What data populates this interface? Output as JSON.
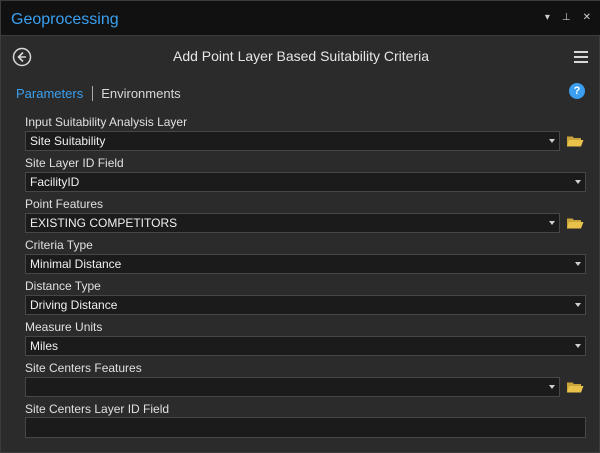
{
  "pane": {
    "title": "Geoprocessing",
    "controls": [
      "▾",
      "⊥",
      "✕"
    ]
  },
  "tool": {
    "title": "Add Point Layer Based Suitability Criteria"
  },
  "tabs": {
    "parameters": "Parameters",
    "environments": "Environments"
  },
  "help": {
    "glyph": "?"
  },
  "params": [
    {
      "label": "Input Suitability Analysis Layer",
      "value": "Site Suitability",
      "dropdown": true,
      "browse": true
    },
    {
      "label": "Site Layer ID Field",
      "value": "FacilityID",
      "dropdown": true,
      "browse": false
    },
    {
      "label": "Point Features",
      "value": "EXISTING COMPETITORS",
      "dropdown": true,
      "browse": true
    },
    {
      "label": "Criteria Type",
      "value": "Minimal Distance",
      "dropdown": true,
      "browse": false
    },
    {
      "label": "Distance Type",
      "value": "Driving Distance",
      "dropdown": true,
      "browse": false
    },
    {
      "label": "Measure Units",
      "value": "Miles",
      "dropdown": true,
      "browse": false
    },
    {
      "label": "Site Centers Features",
      "value": "",
      "dropdown": true,
      "browse": true
    },
    {
      "label": "Site Centers Layer ID Field",
      "value": "",
      "dropdown": false,
      "browse": false
    }
  ],
  "colors": {
    "accent": "#3aa0f0",
    "folder": "#e8c24a",
    "background": "#2b2b2b",
    "field": "#1b1b1b"
  }
}
